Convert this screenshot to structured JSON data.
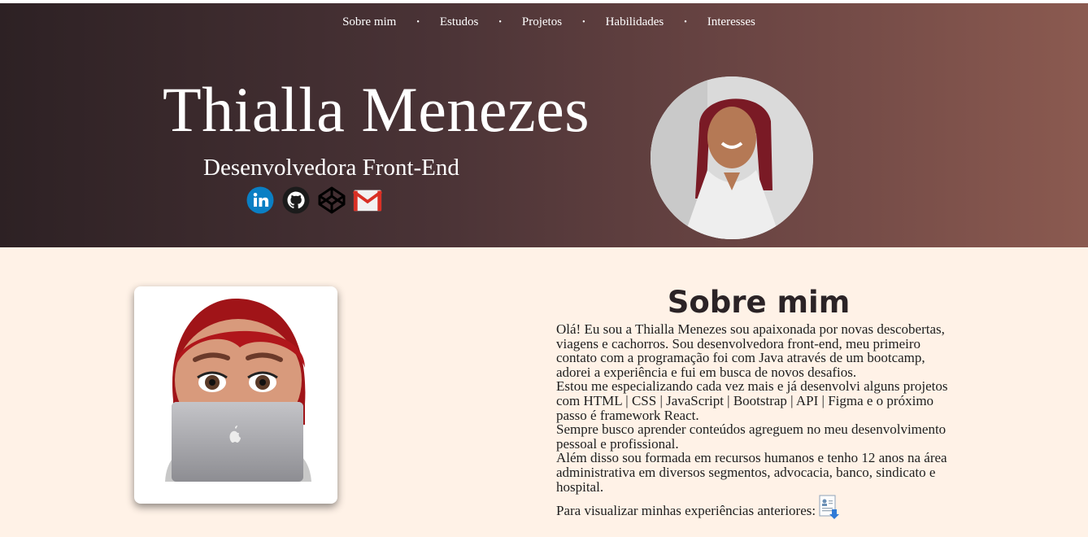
{
  "nav": {
    "items": [
      {
        "label": "Sobre mim"
      },
      {
        "label": "Estudos"
      },
      {
        "label": "Projetos"
      },
      {
        "label": "Habilidades"
      },
      {
        "label": "Interesses"
      }
    ],
    "separator": "•"
  },
  "hero": {
    "name": "Thialla Menezes",
    "role": "Desenvolvedora Front-End",
    "socials": [
      {
        "icon": "linkedin-icon",
        "color": "#0a7fc4"
      },
      {
        "icon": "github-icon",
        "color": "#1b1b1b"
      },
      {
        "icon": "codepen-icon",
        "color": "#000000"
      },
      {
        "icon": "gmail-icon",
        "color": "#d93025"
      }
    ],
    "gradient": [
      "#2d2124",
      "#8b5a50"
    ]
  },
  "about": {
    "title": "Sobre mim",
    "paragraphs": [
      "Olá! Eu sou a Thialla Menezes sou apaixonada por novas descobertas, viagens e cachorros. Sou desenvolvedora front-end, meu primeiro contato com a programação foi com Java através de um bootcamp, adorei a experiência e fui em busca de novos desafios.",
      "Estou me especializando cada vez mais e já desenvolvi alguns projetos com HTML | CSS | JavaScript | Bootstrap | API | Figma e o próximo passo é framework React.",
      "Sempre busco aprender conteúdos agreguem no meu desenvolvimento pessoal e profissional.",
      "Além disso sou formada em recursos humanos e tenho 12 anos na área administrativa em diversos segmentos, advocacia, banco, sindicato e hospital."
    ],
    "cv_text": "Para visualizar minhas experiências anteriores:"
  },
  "colors": {
    "page_background": "#fff2e7",
    "title": "#2b2326"
  }
}
